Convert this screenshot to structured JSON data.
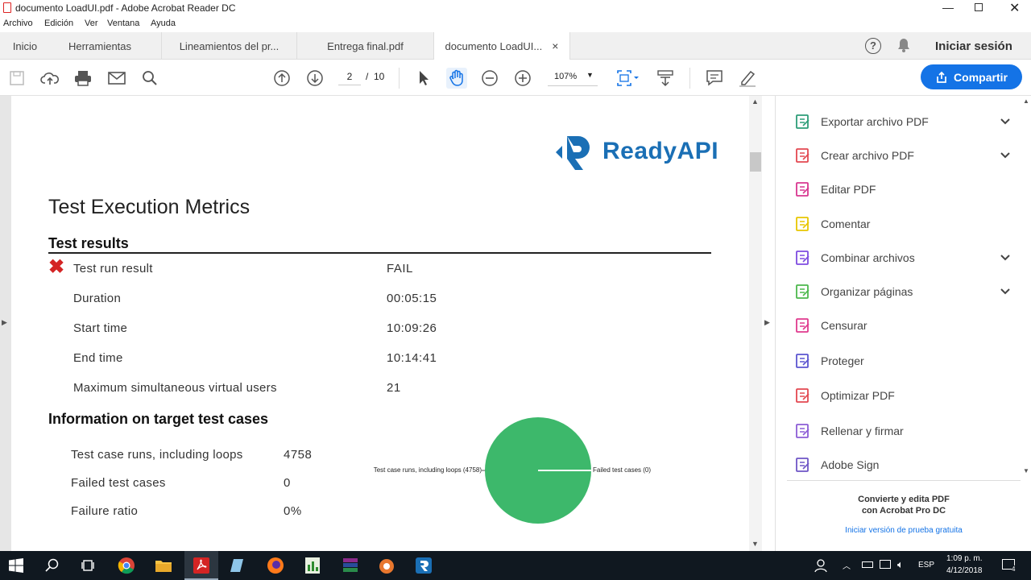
{
  "window": {
    "title": "documento LoadUI.pdf - Adobe Acrobat Reader DC",
    "controls": [
      "minimize",
      "restore",
      "close"
    ]
  },
  "menu": [
    "Archivo",
    "Edición",
    "Ver",
    "Ventana",
    "Ayuda"
  ],
  "tabs": {
    "home": "Inicio",
    "tools": "Herramientas",
    "docs": [
      {
        "label": "Lineamientos del pr...",
        "active": false
      },
      {
        "label": "Entrega final.pdf",
        "active": false
      },
      {
        "label": "documento LoadUI...",
        "active": true
      }
    ],
    "close_glyph": "×",
    "signin": "Iniciar sesión"
  },
  "toolbar": {
    "page_current": "2",
    "page_sep": "/",
    "page_total": "10",
    "zoom": "107%",
    "share_label": "Compartir"
  },
  "document": {
    "logo_text": "ReadyAPI",
    "heading": "Test Execution Metrics",
    "section1": "Test results",
    "results": [
      {
        "label": "Test run result",
        "value": "FAIL"
      },
      {
        "label": "Duration",
        "value": "00:05:15"
      },
      {
        "label": "Start time",
        "value": "10:09:26"
      },
      {
        "label": "End time",
        "value": "10:14:41"
      },
      {
        "label": "Maximum simultaneous virtual users",
        "value": "21"
      }
    ],
    "section2": "Information on target test cases",
    "cases": [
      {
        "label": "Test case runs, including loops",
        "value": "4758"
      },
      {
        "label": "Failed test cases",
        "value": "0"
      },
      {
        "label": "Failure ratio",
        "value": "0%"
      }
    ]
  },
  "chart_data": {
    "type": "pie",
    "categories": [
      "Test case runs, including loops (4758)",
      "Failed test cases (0)"
    ],
    "values": [
      4758,
      0
    ],
    "colors": [
      "#3db86b",
      "#ffffff"
    ]
  },
  "tools_pane": {
    "items": [
      {
        "label": "Exportar archivo PDF",
        "icon": "export-pdf-icon",
        "color": "#2d9d78",
        "expand": true
      },
      {
        "label": "Crear archivo PDF",
        "icon": "create-pdf-icon",
        "color": "#e34850",
        "expand": true
      },
      {
        "label": "Editar PDF",
        "icon": "edit-pdf-icon",
        "color": "#d83790",
        "expand": false
      },
      {
        "label": "Comentar",
        "icon": "comment-icon",
        "color": "#e8c600",
        "expand": false
      },
      {
        "label": "Combinar archivos",
        "icon": "combine-files-icon",
        "color": "#7e4be0",
        "expand": true
      },
      {
        "label": "Organizar páginas",
        "icon": "organize-pages-icon",
        "color": "#4cb84c",
        "expand": true
      },
      {
        "label": "Censurar",
        "icon": "redact-icon",
        "color": "#e03a8e",
        "expand": false
      },
      {
        "label": "Proteger",
        "icon": "protect-icon",
        "color": "#5c55d0",
        "expand": false
      },
      {
        "label": "Optimizar PDF",
        "icon": "optimize-pdf-icon",
        "color": "#e34850",
        "expand": false
      },
      {
        "label": "Rellenar y firmar",
        "icon": "fill-sign-icon",
        "color": "#8c5dd6",
        "expand": false
      },
      {
        "label": "Adobe Sign",
        "icon": "adobe-sign-icon",
        "color": "#6f55c6",
        "expand": false
      }
    ],
    "promo_title_1": "Convierte y edita PDF",
    "promo_title_2": "con Acrobat Pro DC",
    "promo_link": "Iniciar versión de prueba gratuita"
  },
  "taskbar": {
    "lang": "ESP",
    "time": "1:09 p. m.",
    "date": "4/12/2018",
    "notif_count": "4"
  }
}
